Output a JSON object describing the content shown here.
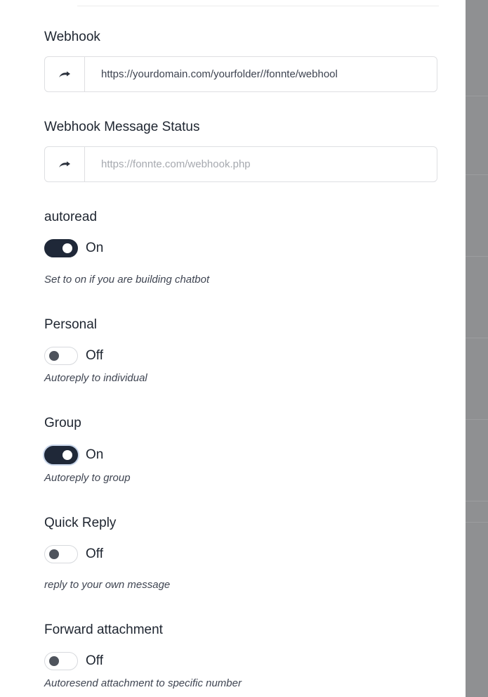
{
  "webhook": {
    "label": "Webhook",
    "value": "https://yourdomain.com/yourfolder//fonnte/webhool",
    "icon": "forward-arrow-icon"
  },
  "webhook_status": {
    "label": "Webhook Message Status",
    "placeholder": "https://fonnte.com/webhook.php",
    "value": "",
    "icon": "forward-arrow-icon"
  },
  "autoread": {
    "label": "autoread",
    "state": "On",
    "hint": "Set to on if you are building chatbot"
  },
  "personal": {
    "label": "Personal",
    "state": "Off",
    "hint": "Autoreply to individual"
  },
  "group": {
    "label": "Group",
    "state": "On",
    "hint": "Autoreply to group"
  },
  "quick_reply": {
    "label": "Quick Reply",
    "state": "Off",
    "hint": "reply to your own message"
  },
  "forward_attachment": {
    "label": "Forward attachment",
    "state": "Off",
    "hint": "Autoresend attachment to specific number"
  },
  "colors": {
    "toggle_on": "#1f2838",
    "toggle_off_knob": "#4e535c",
    "border": "#dedfe2",
    "overlay": "#8f9092"
  }
}
